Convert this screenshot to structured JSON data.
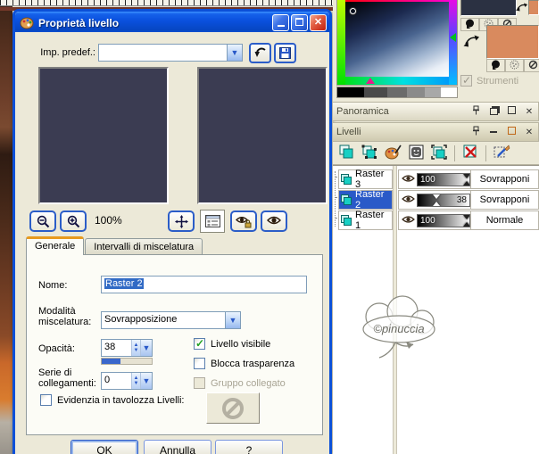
{
  "window": {
    "title": "Proprietà livello"
  },
  "preset": {
    "label": "Imp. predef.:",
    "value": ""
  },
  "toolbar": {
    "zoom_level": "100%"
  },
  "tabs": {
    "general": "Generale",
    "blend_ranges": "Intervalli di miscelatura"
  },
  "form": {
    "name_label": "Nome:",
    "name_value": "Raster 2",
    "blend_label": "Modalità miscelatura:",
    "blend_value": "Sovrapposizione",
    "opacity_label": "Opacità:",
    "opacity_value": "38",
    "opacity_percent": 38,
    "visible_label": "Livello visibile",
    "lock_transparency_label": "Blocca trasparenza",
    "group_label": "Gruppo collegato",
    "link_set_label": "Serie di collegamenti:",
    "link_set_value": "0",
    "highlight_label": "Evidenzia in tavolozza Livelli:"
  },
  "dialog_buttons": {
    "ok": "OK",
    "cancel": "Annulla",
    "help": "?"
  },
  "materials": {
    "tools_label": "Strumenti",
    "foreground_color": "#2b3142",
    "background_color": "#d98a5e",
    "corner_color": "#d98a5e"
  },
  "colors": {
    "preview_fill": "#3b3c52"
  },
  "panels": {
    "overview_title": "Panoramica",
    "layers_title": "Livelli"
  },
  "layers": {
    "rows": [
      {
        "name": "Raster 3",
        "opacity": "100",
        "opacity_pct": 97,
        "blend": "Sovrapponi",
        "selected": false
      },
      {
        "name": "Raster 2",
        "opacity": "38",
        "opacity_pct": 38,
        "blend": "Sovrapponi",
        "selected": true
      },
      {
        "name": "Raster 1",
        "opacity": "100",
        "opacity_pct": 97,
        "blend": "Normale",
        "selected": false
      }
    ]
  },
  "watermark": {
    "text": "©pinuccia"
  }
}
